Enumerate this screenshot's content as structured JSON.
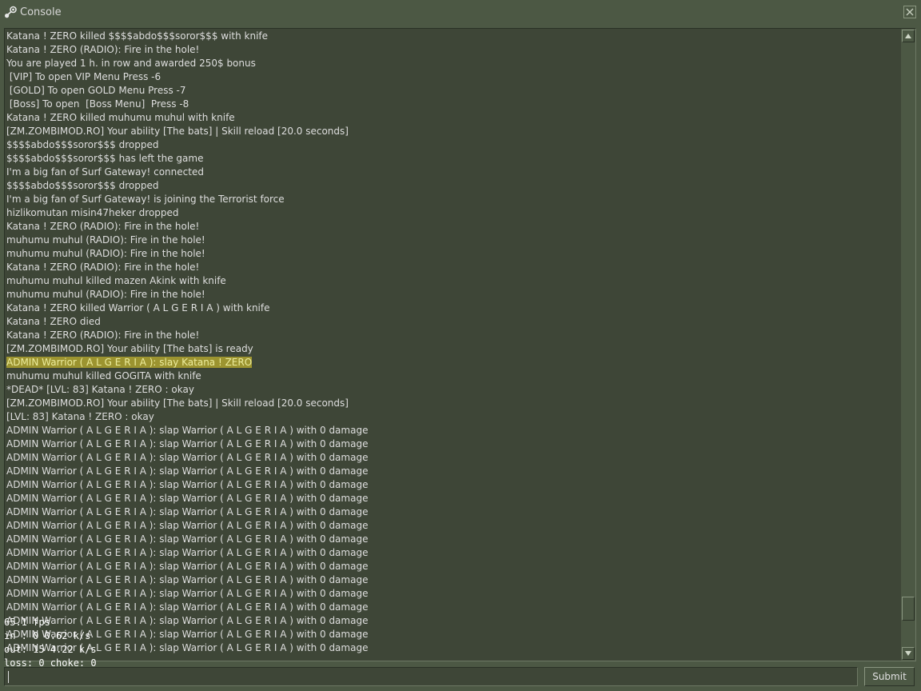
{
  "window": {
    "title": "Console",
    "icon": "steam-icon",
    "close_icon": "close-icon"
  },
  "log": [
    "Katana ! ZERO killed $$$$abdo$$$soror$$$ with knife",
    "Katana ! ZERO (RADIO): Fire in the hole!",
    "You are played 1 h. in row and awarded 250$ bonus",
    " [VIP] To open VIP Menu Press -6",
    " [GOLD] To open GOLD Menu Press -7",
    " [Boss] To open  [Boss Menu]  Press -8",
    "Katana ! ZERO killed muhumu muhul with knife",
    "[ZM.ZOMBIMOD.RO] Your ability [The bats] | Skill reload [20.0 seconds]",
    "$$$$abdo$$$soror$$$ dropped",
    "$$$$abdo$$$soror$$$ has left the game",
    "I'm a big fan of Surf Gateway! connected",
    "$$$$abdo$$$soror$$$ dropped",
    "I'm a big fan of Surf Gateway! is joining the Terrorist force",
    "hizlikomutan misin47heker dropped",
    "Katana ! ZERO (RADIO): Fire in the hole!",
    "muhumu muhul (RADIO): Fire in the hole!",
    "muhumu muhul (RADIO): Fire in the hole!",
    "Katana ! ZERO (RADIO): Fire in the hole!",
    "muhumu muhul killed mazen Akink with knife",
    "muhumu muhul (RADIO): Fire in the hole!",
    "Katana ! ZERO killed Warrior ( A L G E R I A ) with knife",
    "Katana ! ZERO died",
    "Katana ! ZERO (RADIO): Fire in the hole!",
    "[ZM.ZOMBIMOD.RO] Your ability [The bats] is ready",
    "ADMIN Warrior ( A L G E R I A ): slay Katana ! ZERO",
    "muhumu muhul killed GOGITA with knife",
    "*DEAD* [LVL: 83] Katana ! ZERO : okay",
    "[ZM.ZOMBIMOD.RO] Your ability [The bats] | Skill reload [20.0 seconds]",
    "[LVL: 83] Katana ! ZERO : okay",
    "ADMIN Warrior ( A L G E R I A ): slap Warrior ( A L G E R I A ) with 0 damage",
    "ADMIN Warrior ( A L G E R I A ): slap Warrior ( A L G E R I A ) with 0 damage",
    "ADMIN Warrior ( A L G E R I A ): slap Warrior ( A L G E R I A ) with 0 damage",
    "ADMIN Warrior ( A L G E R I A ): slap Warrior ( A L G E R I A ) with 0 damage",
    "ADMIN Warrior ( A L G E R I A ): slap Warrior ( A L G E R I A ) with 0 damage",
    "ADMIN Warrior ( A L G E R I A ): slap Warrior ( A L G E R I A ) with 0 damage",
    "ADMIN Warrior ( A L G E R I A ): slap Warrior ( A L G E R I A ) with 0 damage",
    "ADMIN Warrior ( A L G E R I A ): slap Warrior ( A L G E R I A ) with 0 damage",
    "ADMIN Warrior ( A L G E R I A ): slap Warrior ( A L G E R I A ) with 0 damage",
    "ADMIN Warrior ( A L G E R I A ): slap Warrior ( A L G E R I A ) with 0 damage",
    "ADMIN Warrior ( A L G E R I A ): slap Warrior ( A L G E R I A ) with 0 damage",
    "ADMIN Warrior ( A L G E R I A ): slap Warrior ( A L G E R I A ) with 0 damage",
    "ADMIN Warrior ( A L G E R I A ): slap Warrior ( A L G E R I A ) with 0 damage",
    "ADMIN Warrior ( A L G E R I A ): slap Warrior ( A L G E R I A ) with 0 damage",
    "ADMIN Warrior ( A L G E R I A ): slap Warrior ( A L G E R I A ) with 0 damage",
    "ADMIN Warrior ( A L G E R I A ): slap Warrior ( A L G E R I A ) with 0 damage",
    "ADMIN Warrior ( A L G E R I A ): slap Warrior ( A L G E R I A ) with 0 damage"
  ],
  "highlight_line": 24,
  "highlight_color": "#9c9430",
  "netgraph": {
    "fps": "65.1 fps",
    "in": "in :  0 0.62 k/s",
    "out": "out: 15 4.22 k/s",
    "loss": "loss: 0 choke:  0"
  },
  "input": {
    "value": "",
    "placeholder": ""
  },
  "submit_label": "Submit",
  "colors": {
    "background": "#4c5844",
    "panel": "#3e4637",
    "text": "#dedede"
  }
}
